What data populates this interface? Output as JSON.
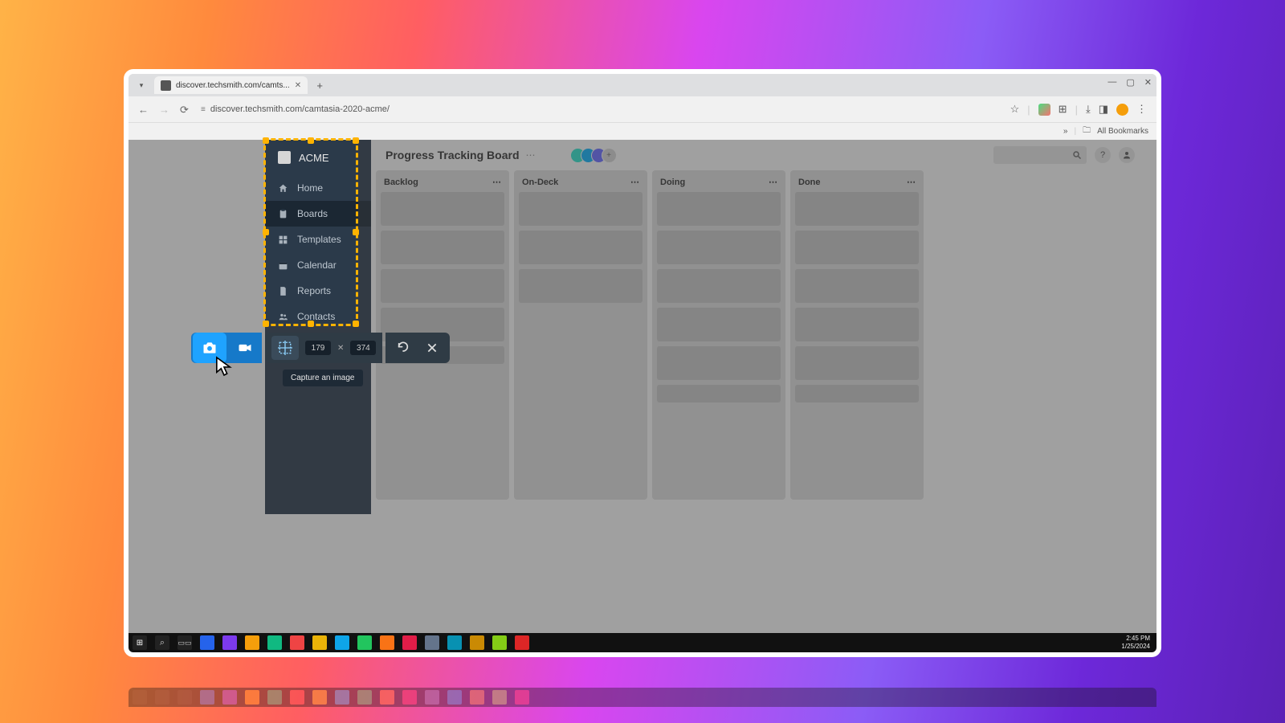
{
  "browser": {
    "tab_title": "discover.techsmith.com/camts...",
    "url": "discover.techsmith.com/camtasia-2020-acme/",
    "bookmarks_label": "All Bookmarks"
  },
  "app": {
    "brand": "ACME",
    "nav": [
      {
        "label": "Home"
      },
      {
        "label": "Boards"
      },
      {
        "label": "Templates"
      },
      {
        "label": "Calendar"
      },
      {
        "label": "Reports"
      },
      {
        "label": "Contacts"
      }
    ],
    "page_title": "Progress Tracking Board",
    "columns": [
      {
        "title": "Backlog",
        "cards": 5,
        "short_last": true
      },
      {
        "title": "On-Deck",
        "cards": 3
      },
      {
        "title": "Doing",
        "cards": 6,
        "short_last": true
      },
      {
        "title": "Done",
        "cards": 6,
        "short_last": true
      }
    ]
  },
  "capture": {
    "width": "179",
    "height": "374",
    "tooltip": "Capture an image"
  },
  "system": {
    "time": "2:45 PM",
    "date": "1/25/2024"
  },
  "colors": {
    "accent": "#1fa3ff",
    "marquee": "#ffb300",
    "sidebar": "#2b3a4a"
  }
}
